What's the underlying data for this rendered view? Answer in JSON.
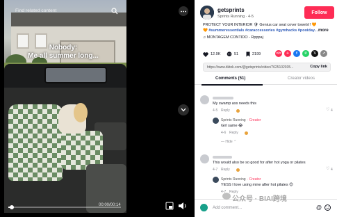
{
  "video": {
    "top_text": "Find related content",
    "caption_line_1": "Nobody:",
    "caption_line_2": "Me all summer long...",
    "timestamp": "00:00/00:14",
    "progress_fraction": 0.03
  },
  "author": {
    "name": "getsprints",
    "subtitle": "Sprints Running · 4-5",
    "follow_label": "Follow"
  },
  "description": {
    "line_1": "PROTECT YOUR INTERIOR 🛡 Genius car seat cover towels!! 🧡",
    "line_2": "🧡 #summeressentials #caraccessories #gymhacks #pooiday...",
    "more_label": "more",
    "music": "♫ MONTAGEM CONTIDO - Rpppaj"
  },
  "stats": {
    "likes": "12.9K",
    "comments": "51",
    "saves": "2199"
  },
  "share_icons": [
    {
      "name": "embed-icon",
      "color": "#fe2c55",
      "glyph": "</>"
    },
    {
      "name": "friends-icon",
      "color": "#fe2c55",
      "glyph": "✈"
    },
    {
      "name": "facebook-icon",
      "color": "#1877f2",
      "glyph": "f"
    },
    {
      "name": "whatsapp-icon",
      "color": "#25d366",
      "glyph": "✆"
    },
    {
      "name": "twitter-icon",
      "color": "#111111",
      "glyph": "𝕏"
    },
    {
      "name": "share-more-icon",
      "color": "#888888",
      "glyph": "↗"
    }
  ],
  "url": {
    "text": "https://www.tiktok.com/@getsprints/video/7625102035...",
    "copy_label": "Copy link"
  },
  "tabs": {
    "comments": "Comments (51)",
    "creator": "Creator videos"
  },
  "comments": [
    {
      "text": "My swamp ass needs this",
      "meta": "4-5",
      "reply": "Reply",
      "likes": "4"
    },
    {
      "reply_name": "Sprints Running",
      "reply_tag": "· Creator",
      "reply_text": "Girl same 😂",
      "reply_meta": "4-6",
      "reply_label": "Reply"
    },
    {
      "hide_label": "Hide"
    },
    {
      "text": "This would also be so good for after hot yoga or pilates",
      "meta": "4-7",
      "reply": "Reply",
      "likes": "4"
    },
    {
      "reply_name": "Sprints Running",
      "reply_tag": "· Creator",
      "reply_text": "YESS I love using mine after hot pilates 😍",
      "reply_meta": "4-7",
      "reply_label": "Reply"
    }
  ],
  "comment_bar": {
    "placeholder": "Add comment...",
    "at": "@"
  },
  "watermark": "公众号 · BIAI跨境"
}
